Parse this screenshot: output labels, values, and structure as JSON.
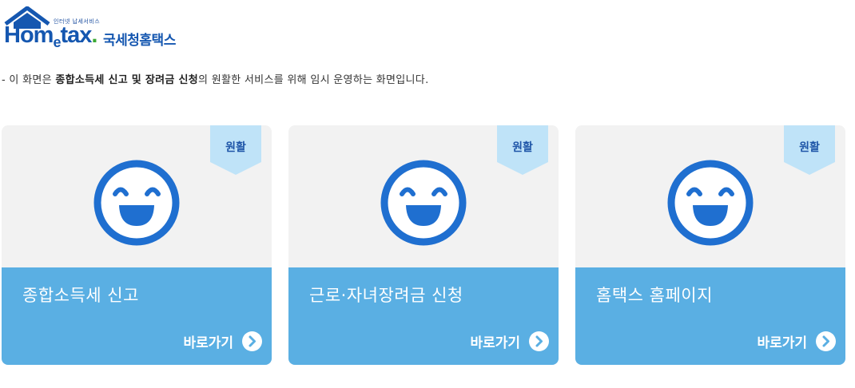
{
  "logo": {
    "small_text": "인터넷 납세서비스",
    "brand_prefix": "Hom",
    "brand_e": "e",
    "brand_suffix": "tax",
    "brand_dot": ".",
    "korean_name": "국세청홈택스"
  },
  "notice": {
    "prefix": "- 이 화면은 ",
    "bold": "종합소득세 신고 및 장려금 신청",
    "suffix": "의 원활한 서비스를 위해 임시 운영하는 화면입니다."
  },
  "cards": [
    {
      "status": "원활",
      "title": "종합소득세 신고",
      "link_label": "바로가기"
    },
    {
      "status": "원활",
      "title": "근로·자녀장려금 신청",
      "link_label": "바로가기"
    },
    {
      "status": "원활",
      "title": "홈택스 홈페이지",
      "link_label": "바로가기"
    }
  ],
  "colors": {
    "brand_blue": "#1557b0",
    "card_accent": "#5aafe3",
    "card_background": "#f2f2f2",
    "ribbon": "#bfe3f8",
    "face": "#1f6fd0"
  },
  "icons": {
    "face": "smiley-face-icon",
    "link": "chevron-right-circle-icon",
    "logo": "house-roof-icon"
  }
}
